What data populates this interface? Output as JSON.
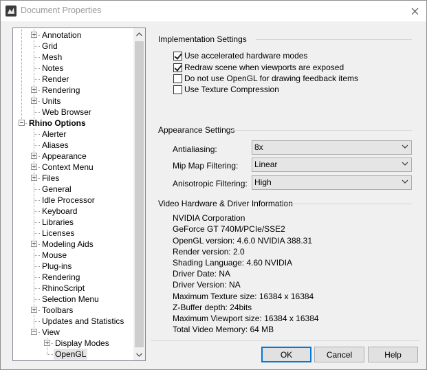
{
  "window": {
    "title": "Document Properties"
  },
  "tree": {
    "items": [
      {
        "label": "Annotation",
        "level": 2,
        "expander": "plus"
      },
      {
        "label": "Grid",
        "level": 2
      },
      {
        "label": "Mesh",
        "level": 2
      },
      {
        "label": "Notes",
        "level": 2
      },
      {
        "label": "Render",
        "level": 2
      },
      {
        "label": "Rendering",
        "level": 2,
        "expander": "plus"
      },
      {
        "label": "Units",
        "level": 2,
        "expander": "plus"
      },
      {
        "label": "Web Browser",
        "level": 2
      },
      {
        "label": "Rhino Options",
        "level": 1,
        "expander": "minus",
        "bold": true
      },
      {
        "label": "Alerter",
        "level": 2
      },
      {
        "label": "Aliases",
        "level": 2
      },
      {
        "label": "Appearance",
        "level": 2,
        "expander": "plus"
      },
      {
        "label": "Context Menu",
        "level": 2,
        "expander": "plus"
      },
      {
        "label": "Files",
        "level": 2,
        "expander": "plus"
      },
      {
        "label": "General",
        "level": 2
      },
      {
        "label": "Idle Processor",
        "level": 2
      },
      {
        "label": "Keyboard",
        "level": 2
      },
      {
        "label": "Libraries",
        "level": 2
      },
      {
        "label": "Licenses",
        "level": 2
      },
      {
        "label": "Modeling Aids",
        "level": 2,
        "expander": "plus"
      },
      {
        "label": "Mouse",
        "level": 2
      },
      {
        "label": "Plug-ins",
        "level": 2
      },
      {
        "label": "Rendering",
        "level": 2
      },
      {
        "label": "RhinoScript",
        "level": 2
      },
      {
        "label": "Selection Menu",
        "level": 2
      },
      {
        "label": "Toolbars",
        "level": 2,
        "expander": "plus"
      },
      {
        "label": "Updates and Statistics",
        "level": 2
      },
      {
        "label": "View",
        "level": 2,
        "expander": "minus"
      },
      {
        "label": "Display Modes",
        "level": 3,
        "expander": "plus"
      },
      {
        "label": "OpenGL",
        "level": 3,
        "selected": true
      }
    ]
  },
  "implementation": {
    "title": "Implementation Settings",
    "options": [
      {
        "label": "Use accelerated hardware modes",
        "checked": true
      },
      {
        "label": "Redraw scene when viewports are exposed",
        "checked": true
      },
      {
        "label": "Do not use OpenGL for drawing feedback items",
        "checked": false
      },
      {
        "label": "Use Texture Compression",
        "checked": false
      }
    ]
  },
  "appearance": {
    "title": "Appearance Settings",
    "antialiasing": {
      "label": "Antialiasing:",
      "value": "8x"
    },
    "mipmap": {
      "label": "Mip Map Filtering:",
      "value": "Linear"
    },
    "anisotropic": {
      "label": "Anisotropic Filtering:",
      "value": "High"
    }
  },
  "hardware": {
    "title": "Video Hardware & Driver Information",
    "lines": [
      "NVIDIA Corporation",
      "GeForce GT 740M/PCIe/SSE2",
      "OpenGL version: 4.6.0 NVIDIA 388.31",
      "Render version: 2.0",
      "Shading Language: 4.60 NVIDIA",
      "Driver Date: NA",
      "Driver Version: NA",
      "Maximum Texture size: 16384 x 16384",
      "Z-Buffer depth: 24bits",
      "Maximum Viewport size: 16384 x 16384",
      "Total Video Memory: 64 MB"
    ]
  },
  "buttons": {
    "ok": "OK",
    "cancel": "Cancel",
    "help": "Help"
  },
  "colors": {
    "accent": "#0078d7",
    "panel": "#f0f0f0"
  }
}
